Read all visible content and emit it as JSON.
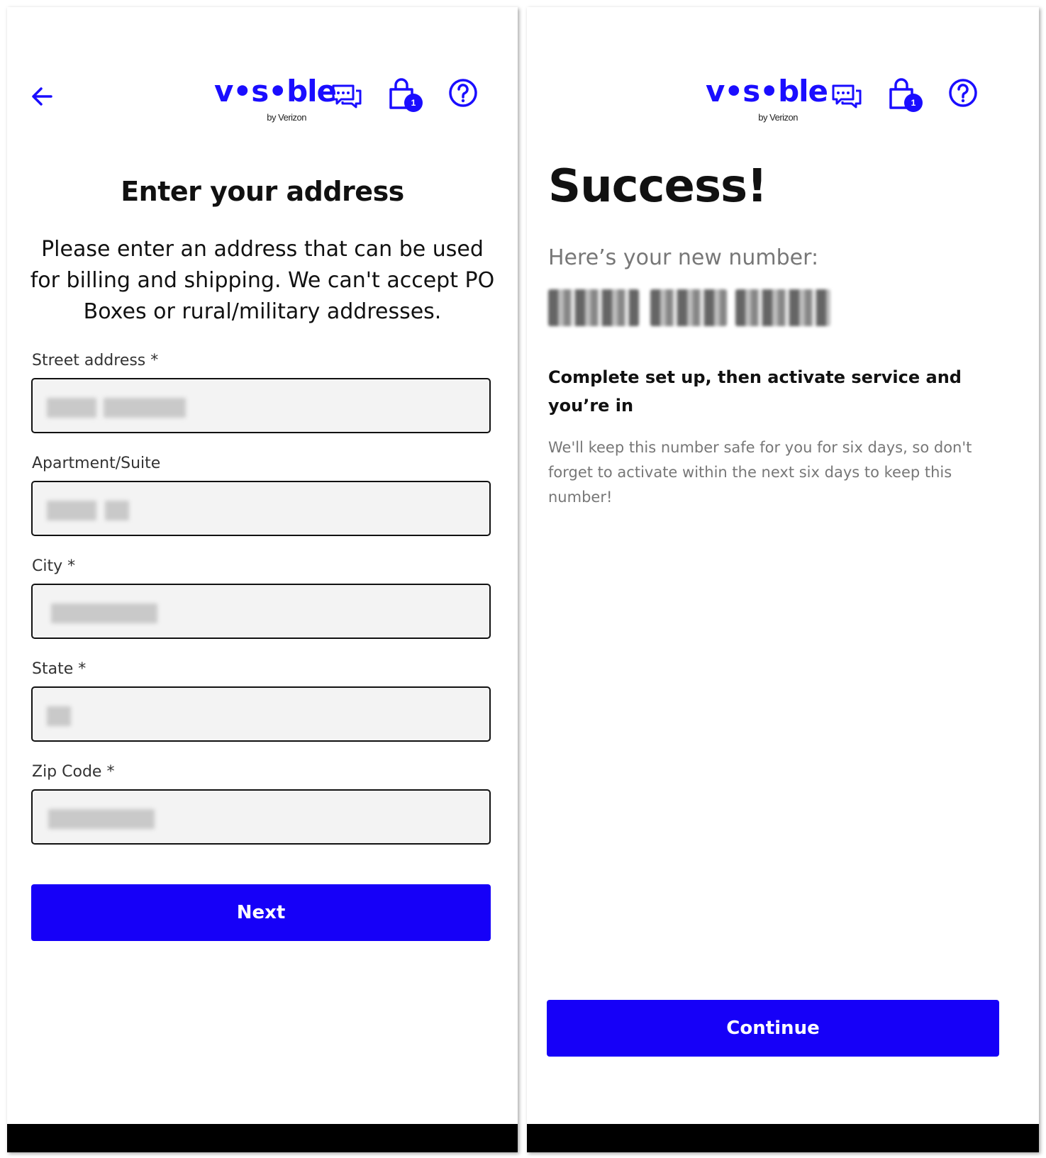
{
  "brand": {
    "name": "v•s•ble",
    "byline": "by Verizon",
    "accent_color": "#1600f8"
  },
  "icons": {
    "back": "arrow-left-icon",
    "chat": "chat-bubbles-icon",
    "cart": "shopping-bag-icon",
    "help": "question-circle-icon"
  },
  "cart": {
    "badge_count": "1"
  },
  "address_form": {
    "title": "Enter your address",
    "intro": "Please enter an address that can be used for billing and shipping. We can't accept PO Boxes or rural/military addresses.",
    "fields": [
      {
        "label": "Street address *",
        "value": ""
      },
      {
        "label": "Apartment/Suite",
        "value": ""
      },
      {
        "label": "City *",
        "value": ""
      },
      {
        "label": "State *",
        "value": ""
      },
      {
        "label": "Zip Code *",
        "value": ""
      }
    ],
    "next_label": "Next"
  },
  "success_screen": {
    "title": "Success!",
    "number_label": "Here’s your new number:",
    "number_value": "",
    "setup_heading": "Complete set up, then activate service and you’re in",
    "note": "We'll keep this number safe for you for six days, so don't forget to activate within the next six days to keep this number!",
    "continue_label": "Continue"
  }
}
